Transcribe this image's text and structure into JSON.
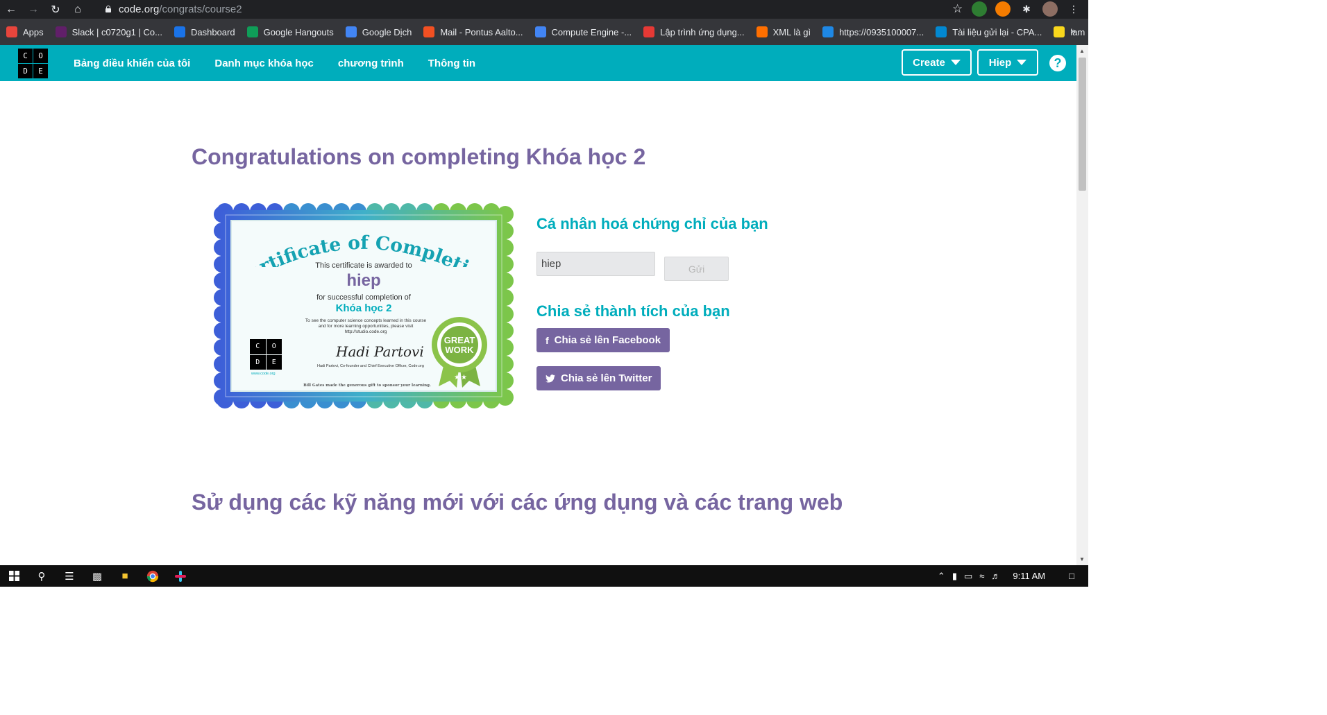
{
  "browser": {
    "url_host": "code.org",
    "url_path": "/congrats/course2",
    "bookmarks": [
      {
        "label": "Apps",
        "color": "#e8453c"
      },
      {
        "label": "Slack | c0720g1 | Co...",
        "color": "#611f69"
      },
      {
        "label": "Dashboard",
        "color": "#1a73e8"
      },
      {
        "label": "Google Hangouts",
        "color": "#0f9d58"
      },
      {
        "label": "Google Dịch",
        "color": "#4285f4"
      },
      {
        "label": "Mail - Pontus Aalto...",
        "color": "#f25022"
      },
      {
        "label": "Compute Engine -...",
        "color": "#4285f4"
      },
      {
        "label": "Lập trình ứng dụng...",
        "color": "#e53935"
      },
      {
        "label": "XML là gì",
        "color": "#ff6f00"
      },
      {
        "label": "https://0935100007...",
        "color": "#1e88e5"
      },
      {
        "label": "Tài liệu gửi lại - CPA...",
        "color": "#0288d1"
      },
      {
        "label": "lam",
        "color": "#f9d71c"
      }
    ],
    "bookmarks_more": "»"
  },
  "header": {
    "logo_letters": [
      "C",
      "O",
      "D",
      "E"
    ],
    "nav": [
      "Bảng điều khiển của tôi",
      "Danh mục khóa học",
      "chương trình",
      "Thông tin"
    ],
    "create_label": "Create",
    "user_label": "Hiep",
    "help_label": "?"
  },
  "main": {
    "title": "Congratulations on completing Khóa học 2",
    "certificate": {
      "heading": "Certificate of Completion",
      "awarded_text": "This certificate is awarded to",
      "name": "hiep",
      "for_text": "for successful completion of",
      "course": "Khóa học 2",
      "small_text_1": "To see the computer science concepts learned in this course",
      "small_text_2": "and for more learning opportunities, please visit",
      "small_text_3": "http://studio.code.org",
      "logo_letters": [
        "C",
        "O",
        "D",
        "E"
      ],
      "site": "www.code.org",
      "signature": "Hadi Partovi",
      "signature_line": "Hadi Partovi, Co-founder and Chief Executive Officer, Code.org",
      "footer": "Bill Gates made the generous gift to sponsor your learning.",
      "badge_line1": "GREAT",
      "badge_line2": "WORK"
    },
    "personalize_heading": "Cá nhân hoá chứng chỉ của bạn",
    "name_input_value": "hiep",
    "send_label": "Gửi",
    "share_heading": "Chia sẻ thành tích của bạn",
    "facebook_label": "Chia sẻ lên Facebook",
    "twitter_label": "Chia sẻ lên Twitter",
    "section2_title": "Sử dụng các kỹ năng mới với các ứng dụng và các trang web"
  },
  "taskbar": {
    "time": "9:11 AM"
  },
  "colors": {
    "brand_teal": "#00adbc",
    "brand_purple": "#7665a0"
  }
}
